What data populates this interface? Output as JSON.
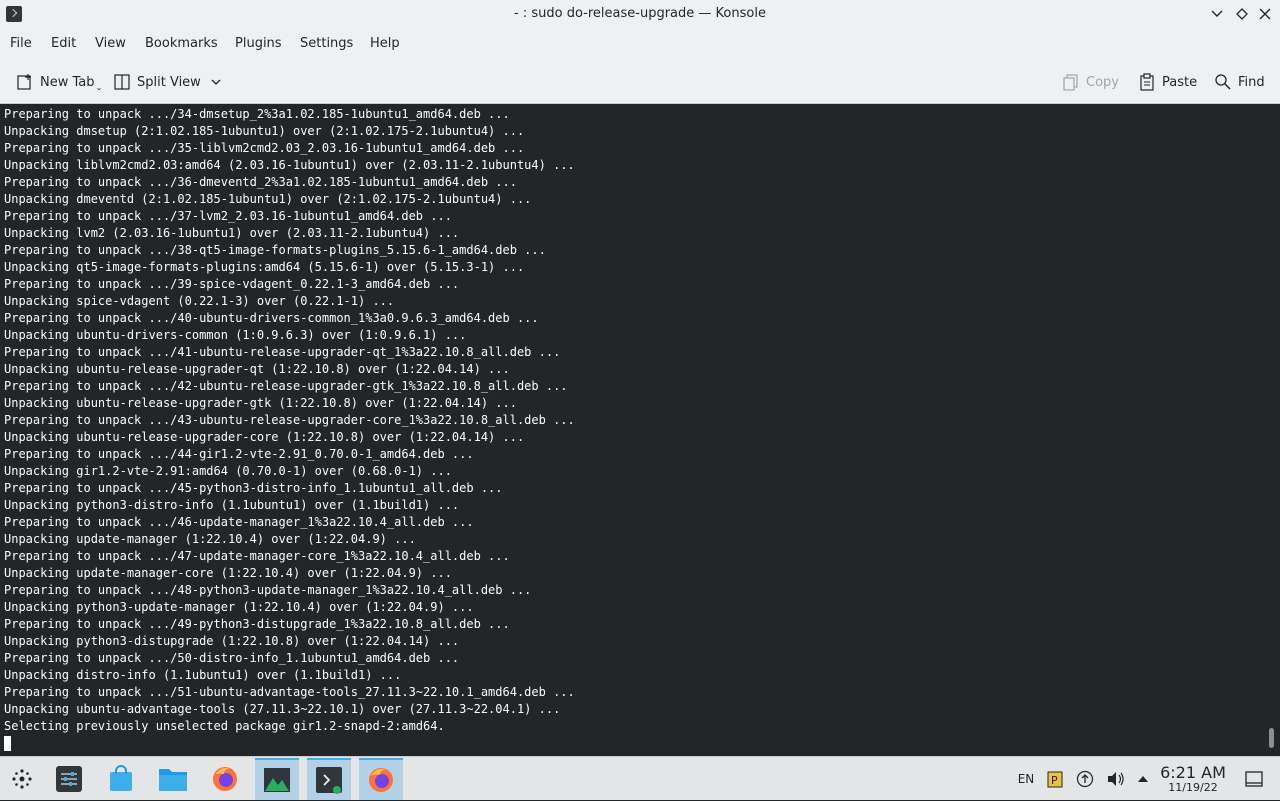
{
  "window": {
    "title": "- : sudo do-release-upgrade — Konsole"
  },
  "menu": [
    "File",
    "Edit",
    "View",
    "Bookmarks",
    "Plugins",
    "Settings",
    "Help"
  ],
  "toolbar": {
    "new_tab": "New Tab",
    "split_view": "Split View",
    "copy": "Copy",
    "paste": "Paste",
    "find": "Find"
  },
  "terminal": {
    "lines": [
      "Preparing to unpack .../34-dmsetup_2%3a1.02.185-1ubuntu1_amd64.deb ...",
      "Unpacking dmsetup (2:1.02.185-1ubuntu1) over (2:1.02.175-2.1ubuntu4) ...",
      "Preparing to unpack .../35-liblvm2cmd2.03_2.03.16-1ubuntu1_amd64.deb ...",
      "Unpacking liblvm2cmd2.03:amd64 (2.03.16-1ubuntu1) over (2.03.11-2.1ubuntu4) ...",
      "Preparing to unpack .../36-dmeventd_2%3a1.02.185-1ubuntu1_amd64.deb ...",
      "Unpacking dmeventd (2:1.02.185-1ubuntu1) over (2:1.02.175-2.1ubuntu4) ...",
      "Preparing to unpack .../37-lvm2_2.03.16-1ubuntu1_amd64.deb ...",
      "Unpacking lvm2 (2.03.16-1ubuntu1) over (2.03.11-2.1ubuntu4) ...",
      "Preparing to unpack .../38-qt5-image-formats-plugins_5.15.6-1_amd64.deb ...",
      "Unpacking qt5-image-formats-plugins:amd64 (5.15.6-1) over (5.15.3-1) ...",
      "Preparing to unpack .../39-spice-vdagent_0.22.1-3_amd64.deb ...",
      "Unpacking spice-vdagent (0.22.1-3) over (0.22.1-1) ...",
      "Preparing to unpack .../40-ubuntu-drivers-common_1%3a0.9.6.3_amd64.deb ...",
      "Unpacking ubuntu-drivers-common (1:0.9.6.3) over (1:0.9.6.1) ...",
      "Preparing to unpack .../41-ubuntu-release-upgrader-qt_1%3a22.10.8_all.deb ...",
      "Unpacking ubuntu-release-upgrader-qt (1:22.10.8) over (1:22.04.14) ...",
      "Preparing to unpack .../42-ubuntu-release-upgrader-gtk_1%3a22.10.8_all.deb ...",
      "Unpacking ubuntu-release-upgrader-gtk (1:22.10.8) over (1:22.04.14) ...",
      "Preparing to unpack .../43-ubuntu-release-upgrader-core_1%3a22.10.8_all.deb ...",
      "Unpacking ubuntu-release-upgrader-core (1:22.10.8) over (1:22.04.14) ...",
      "Preparing to unpack .../44-gir1.2-vte-2.91_0.70.0-1_amd64.deb ...",
      "Unpacking gir1.2-vte-2.91:amd64 (0.70.0-1) over (0.68.0-1) ...",
      "Preparing to unpack .../45-python3-distro-info_1.1ubuntu1_all.deb ...",
      "Unpacking python3-distro-info (1.1ubuntu1) over (1.1build1) ...",
      "Preparing to unpack .../46-update-manager_1%3a22.10.4_all.deb ...",
      "Unpacking update-manager (1:22.10.4) over (1:22.04.9) ...",
      "Preparing to unpack .../47-update-manager-core_1%3a22.10.4_all.deb ...",
      "Unpacking update-manager-core (1:22.10.4) over (1:22.04.9) ...",
      "Preparing to unpack .../48-python3-update-manager_1%3a22.10.4_all.deb ...",
      "Unpacking python3-update-manager (1:22.10.4) over (1:22.04.9) ...",
      "Preparing to unpack .../49-python3-distupgrade_1%3a22.10.8_all.deb ...",
      "Unpacking python3-distupgrade (1:22.10.8) over (1:22.04.14) ...",
      "Preparing to unpack .../50-distro-info_1.1ubuntu1_amd64.deb ...",
      "Unpacking distro-info (1.1ubuntu1) over (1.1build1) ...",
      "Preparing to unpack .../51-ubuntu-advantage-tools_27.11.3~22.10.1_amd64.deb ...",
      "Unpacking ubuntu-advantage-tools (27.11.3~22.10.1) over (27.11.3~22.04.1) ...",
      "Selecting previously unselected package gir1.2-snapd-2:amd64."
    ]
  },
  "tray": {
    "language": "EN",
    "time": "6:21 AM",
    "date": "11/19/22"
  },
  "colors": {
    "terminal_bg": "#232629",
    "terminal_fg": "#fcfcfc",
    "chrome_bg": "#eff0f1",
    "taskbar_bg": "#e3e5e7",
    "accent": "#3daee9"
  }
}
